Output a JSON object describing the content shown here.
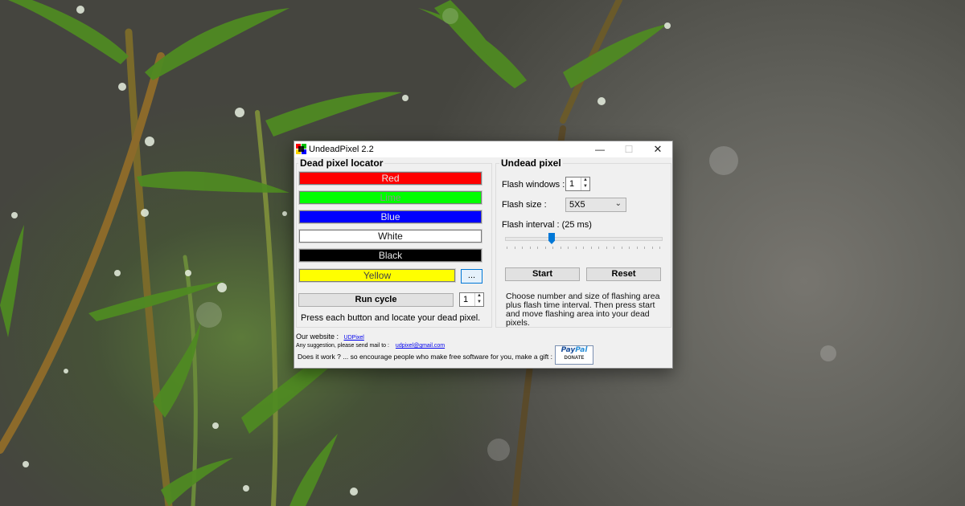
{
  "window": {
    "title": "UndeadPixel 2.2",
    "minimize_glyph": "—",
    "maximize_glyph": "☐",
    "close_glyph": "✕"
  },
  "locator": {
    "title": "Dead pixel locator",
    "buttons": [
      {
        "label": "Red",
        "bg": "#ff0000",
        "fg": "#e9e9e9"
      },
      {
        "label": "Lime",
        "bg": "#00ff00",
        "fg": "#8e8e8e"
      },
      {
        "label": "Blue",
        "bg": "#0000ff",
        "fg": "#e8e8e8"
      },
      {
        "label": "White",
        "bg": "#ffffff",
        "fg": "#111111"
      },
      {
        "label": "Black",
        "bg": "#000000",
        "fg": "#e8e8e8"
      },
      {
        "label": "Yellow",
        "bg": "#ffff00",
        "fg": "#444444"
      }
    ],
    "custom_color_button": "...",
    "run_cycle_label": "Run cycle",
    "cycle_count": "1",
    "hint": "Press each button and locate your dead pixel."
  },
  "undead": {
    "title": "Undead pixel",
    "flash_windows_label": "Flash windows :",
    "flash_windows_value": "1",
    "flash_size_label": "Flash size :",
    "flash_size_value": "5X5",
    "flash_interval_label": "Flash interval : (25 ms)",
    "slider_level": 0.3,
    "start_label": "Start",
    "reset_label": "Reset",
    "description": "Choose number and size of flashing area plus flash time interval. Then press start and move flashing area into your dead pixels."
  },
  "footer": {
    "website_label": "Our website :",
    "website_link": "UDPixel",
    "mail_label": "Any suggestion, please send mail to :",
    "mail_link": "udpixel@gmail.com",
    "gift_text": "Does it work ? ... so encourage people who make free software for you, make a gift :",
    "paypal_pay": "Pay",
    "paypal_pal": "Pal",
    "paypal_donate": "DONATE"
  }
}
